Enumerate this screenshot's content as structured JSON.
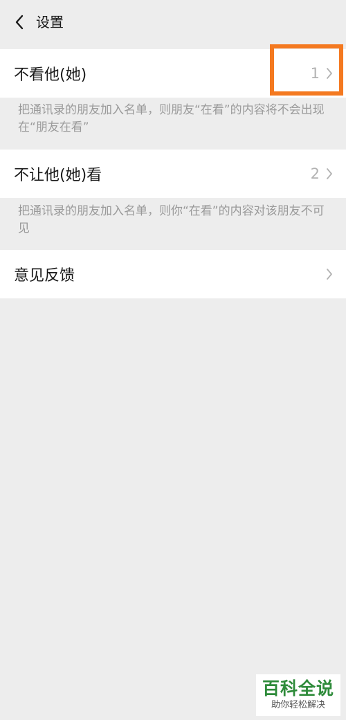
{
  "header": {
    "title": "设置"
  },
  "rows": [
    {
      "label": "不看他(她)",
      "value": "1",
      "description": "把通讯录的朋友加入名单，则朋友“在看”的内容将不会出现在“朋友在看”"
    },
    {
      "label": "不让他(她)看",
      "value": "2",
      "description": "把通讯录的朋友加入名单，则你“在看”的内容对该朋友不可见"
    },
    {
      "label": "意见反馈"
    }
  ],
  "annotation": {
    "highlight_color": "#f47920"
  },
  "watermark": {
    "title": "百科全说",
    "subtitle": "助你轻松解决"
  },
  "icons": {
    "back": "chevron-left-icon",
    "row_arrow": "chevron-right-icon"
  }
}
